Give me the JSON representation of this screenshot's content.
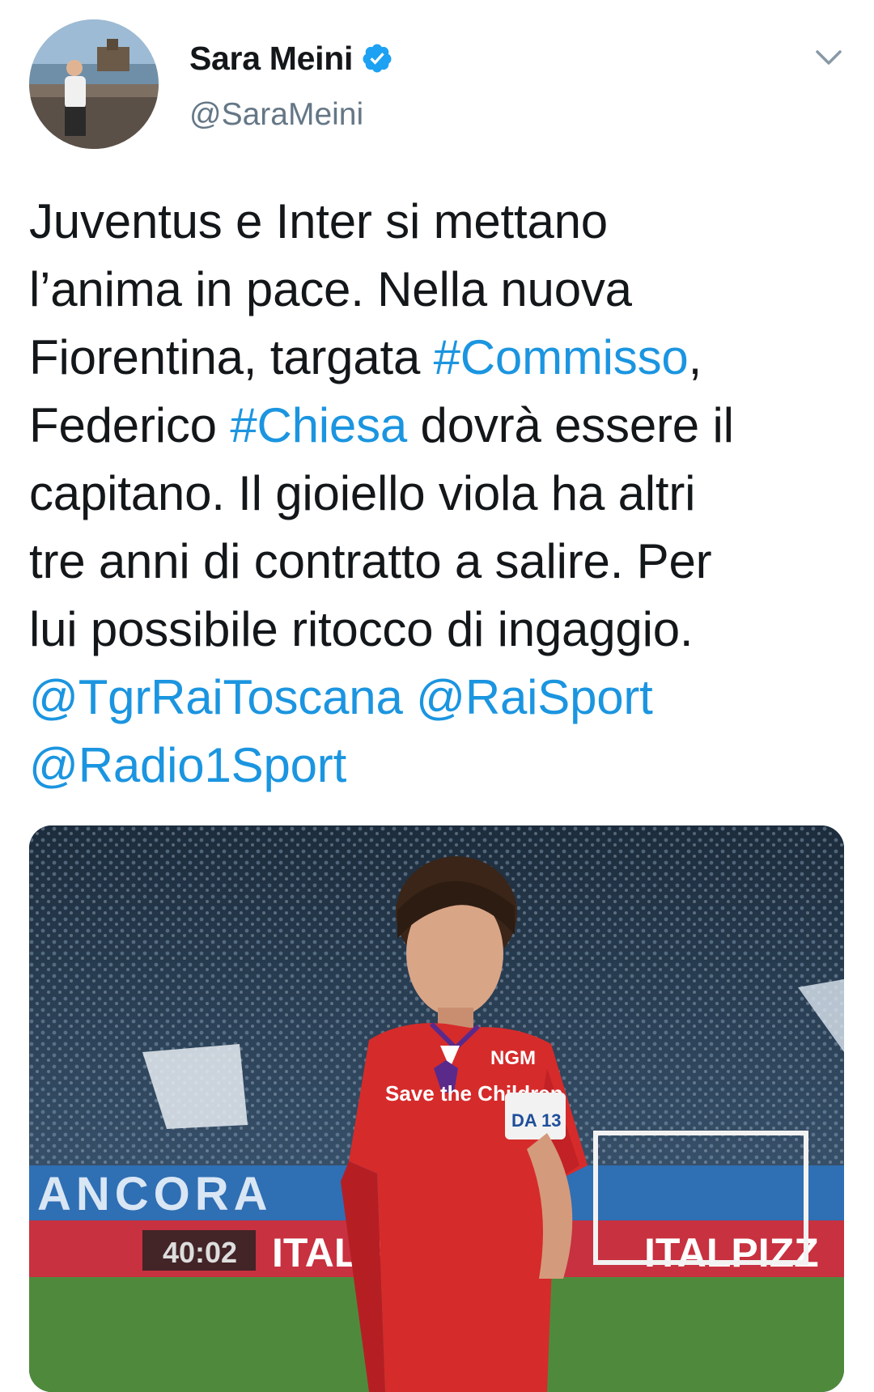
{
  "user": {
    "display_name": "Sara Meini",
    "handle": "@SaraMeini",
    "verified": true
  },
  "tweet": {
    "lines": [
      [
        {
          "t": "Juventus e Inter si mettano"
        }
      ],
      [
        {
          "t": "l’anima in pace. Nella nuova"
        }
      ],
      [
        {
          "t": "Fiorentina, targata "
        },
        {
          "t": "#Commisso",
          "link": true
        },
        {
          "t": ","
        }
      ],
      [
        {
          "t": "Federico "
        },
        {
          "t": "#Chiesa",
          "link": true
        },
        {
          "t": " dovrà essere il"
        }
      ],
      [
        {
          "t": "capitano. Il gioiello viola ha altri"
        }
      ],
      [
        {
          "t": "tre anni di contratto a salire. Per"
        }
      ],
      [
        {
          "t": "lui possibile ritocco di ingaggio."
        }
      ],
      [
        {
          "t": "@TgrRaiToscana",
          "link": true
        },
        {
          "t": " "
        },
        {
          "t": "@RaiSport",
          "link": true
        }
      ],
      [
        {
          "t": "@Radio1Sport",
          "link": true
        }
      ]
    ]
  },
  "media": {
    "jersey_sponsor": "Save the Children",
    "jersey_brand": "NGM",
    "armband": "DA 13",
    "board_texts": [
      "ANCORA",
      "ITALPIZZ",
      "ITALPIZZ"
    ],
    "scoreboard": "40:02"
  },
  "icons": {
    "verified": "verified-badge-icon",
    "more": "chevron-down-icon"
  },
  "colors": {
    "link": "#1b95e0",
    "text": "#14171a",
    "secondary": "#657786",
    "verified": "#1da1f2",
    "jersey": "#d62b2b"
  }
}
